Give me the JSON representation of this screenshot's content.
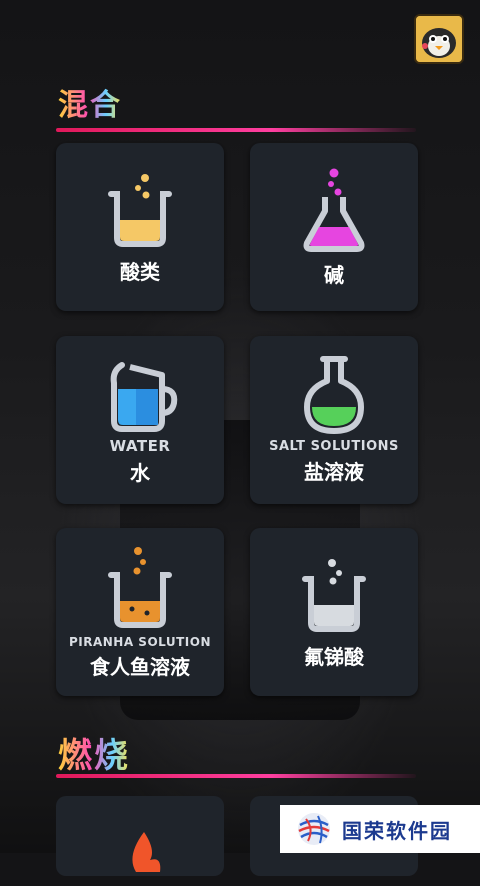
{
  "sections": {
    "mix_title": "混合",
    "burn_title": "燃烧"
  },
  "cards": [
    {
      "cn": "酸类",
      "en": ""
    },
    {
      "cn": "碱",
      "en": ""
    },
    {
      "cn": "水",
      "en": "WATER"
    },
    {
      "cn": "盐溶液",
      "en": "SALT SOLUTIONS"
    },
    {
      "cn": "食人鱼溶液",
      "en": "PIRANHA SOLUTION"
    },
    {
      "cn": "氟锑酸",
      "en": ""
    }
  ],
  "watermark": {
    "text": "国荣软件园"
  },
  "colors": {
    "acid": "#f5c866",
    "base": "#e645e0",
    "water": "#3aa8f0",
    "salt": "#56d05a",
    "piranha": "#e8922e",
    "fluoro": "#d7dbe0",
    "accent_line": "#e0195a"
  }
}
